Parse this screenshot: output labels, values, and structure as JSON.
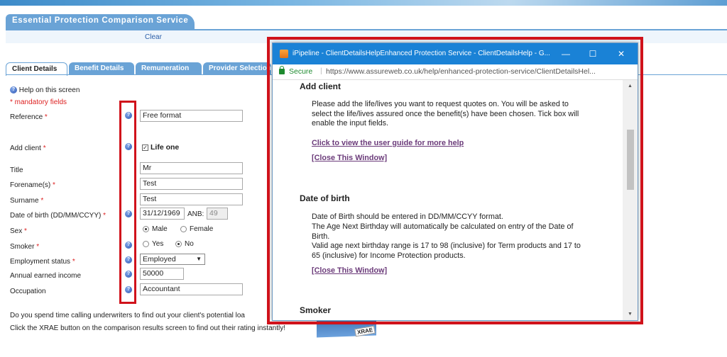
{
  "service_title": "Essential Protection Comparison Service",
  "clear_label": "Clear",
  "tabs": [
    "Client Details",
    "Benefit Details",
    "Remuneration",
    "Provider Selection"
  ],
  "form": {
    "help_label": "Help on this screen",
    "mandatory_note": "* mandatory fields",
    "reference_label": "Reference",
    "reference_value": "Free format",
    "add_client_label": "Add client",
    "life_one_label": "Life one",
    "title_label": "Title",
    "title_value": "Mr",
    "forenames_label": "Forename(s)",
    "forenames_value": "Test",
    "surname_label": "Surname",
    "surname_value": "Test",
    "dob_label": "Date of birth (DD/MM/CCYY)",
    "dob_value": "31/12/1969",
    "anb_label": "ANB:",
    "anb_value": "49",
    "sex_label": "Sex",
    "sex_options": [
      "Male",
      "Female"
    ],
    "sex_selected": "Male",
    "smoker_label": "Smoker",
    "smoker_options": [
      "Yes",
      "No"
    ],
    "smoker_selected": "No",
    "employment_label": "Employment status",
    "employment_value": "Employed",
    "income_label": "Annual earned income",
    "income_value": "50000",
    "occupation_label": "Occupation",
    "occupation_value": "Accountant",
    "required_marker": "*"
  },
  "bottom": {
    "line1": "Do you spend time calling underwriters to find out your client's potential loa",
    "line2": "Click the XRAE button on the comparison results screen to find out their rating instantly!",
    "xrae_label": "XRAE"
  },
  "popup": {
    "title": "iPipeline - ClientDetailsHelpEnhanced Protection Service - ClientDetailsHelp - G...",
    "secure_label": "Secure",
    "url": "https://www.assureweb.co.uk/help/enhanced-protection-service/ClientDetailsHel...",
    "minimize": "—",
    "maximize": "☐",
    "close": "✕",
    "sections": {
      "add_client": {
        "heading": "Add client",
        "text": "Please add the life/lives you want to request quotes on. You will be asked to select the life/lives assured once the benefit(s) have been chosen. Tick box will enable the input fields.",
        "user_guide_link": "Click to view the user guide for more help",
        "close_link": "[Close This Window]"
      },
      "dob": {
        "heading": "Date of birth",
        "text_lines": [
          "Date of Birth should be entered in DD/MM/CCYY format.",
          "The Age Next Birthday will automatically be calculated on entry of the Date of Birth.",
          "Valid age next birthday range is 17 to 98 (inclusive) for Term products and 17 to 65 (inclusive) for Income Protection products."
        ],
        "close_link": "[Close This Window]"
      },
      "smoker": {
        "heading": "Smoker"
      }
    }
  },
  "colors": {
    "accent": "#6aa3d6",
    "titlebar": "#1a82d6",
    "highlight": "#d0121b",
    "link": "#6b3b7a"
  }
}
